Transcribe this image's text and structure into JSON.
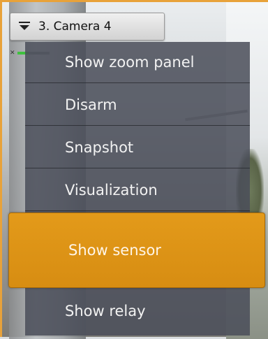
{
  "camera": {
    "title": "3. Camera 4",
    "menu_icon": "dropdown-menu-icon"
  },
  "indicator": {
    "icon": "signal-icon",
    "level": 0.35,
    "color": "#3ec23e"
  },
  "context_menu": {
    "items": [
      {
        "label": "Show zoom panel"
      },
      {
        "label": "Disarm"
      },
      {
        "label": "Snapshot"
      },
      {
        "label": "Visualization"
      },
      {
        "label": "Show sensor",
        "highlighted": true
      },
      {
        "label": "Show relay"
      }
    ]
  },
  "colors": {
    "highlight": "#e39a1a",
    "border_accent": "#e8a23a",
    "menu_bg": "#4a4e5a"
  }
}
